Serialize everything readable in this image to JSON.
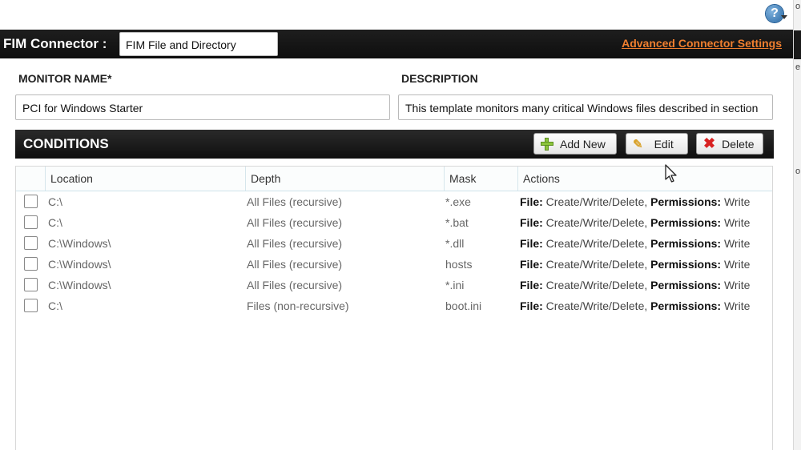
{
  "header": {
    "title": "FIM Connector :",
    "connector_value": "FIM File and Directory",
    "advanced_link": "Advanced Connector Settings"
  },
  "form": {
    "monitor_name_label": "MONITOR NAME*",
    "monitor_name_value": "PCI for Windows Starter",
    "description_label": "DESCRIPTION",
    "description_value": "This template monitors many critical Windows files described in section"
  },
  "conditions": {
    "title": "CONDITIONS",
    "add_label": "Add New",
    "edit_label": "Edit",
    "delete_label": "Delete",
    "columns": [
      "Location",
      "Depth",
      "Mask",
      "Actions"
    ],
    "rows": [
      {
        "location": "C:\\",
        "depth": "All Files (recursive)",
        "mask": "*.exe",
        "file_label": "File:",
        "file_actions": "Create/Write/Delete,",
        "perm_label": "Permissions:",
        "perm_actions": "Write"
      },
      {
        "location": "C:\\",
        "depth": "All Files (recursive)",
        "mask": "*.bat",
        "file_label": "File:",
        "file_actions": "Create/Write/Delete,",
        "perm_label": "Permissions:",
        "perm_actions": "Write"
      },
      {
        "location": "C:\\Windows\\",
        "depth": "All Files (recursive)",
        "mask": "*.dll",
        "file_label": "File:",
        "file_actions": "Create/Write/Delete,",
        "perm_label": "Permissions:",
        "perm_actions": "Write"
      },
      {
        "location": "C:\\Windows\\",
        "depth": "All Files (recursive)",
        "mask": "hosts",
        "file_label": "File:",
        "file_actions": "Create/Write/Delete,",
        "perm_label": "Permissions:",
        "perm_actions": "Write"
      },
      {
        "location": "C:\\Windows\\",
        "depth": "All Files (recursive)",
        "mask": "*.ini",
        "file_label": "File:",
        "file_actions": "Create/Write/Delete,",
        "perm_label": "Permissions:",
        "perm_actions": "Write"
      },
      {
        "location": "C:\\",
        "depth": "Files (non-recursive)",
        "mask": "boot.ini",
        "file_label": "File:",
        "file_actions": "Create/Write/Delete,",
        "perm_label": "Permissions:",
        "perm_actions": "Write"
      }
    ]
  },
  "right_edge": {
    "letters": [
      "o",
      "e",
      "o"
    ]
  },
  "colors": {
    "link": "#f07f2f",
    "bar": "#111111"
  }
}
